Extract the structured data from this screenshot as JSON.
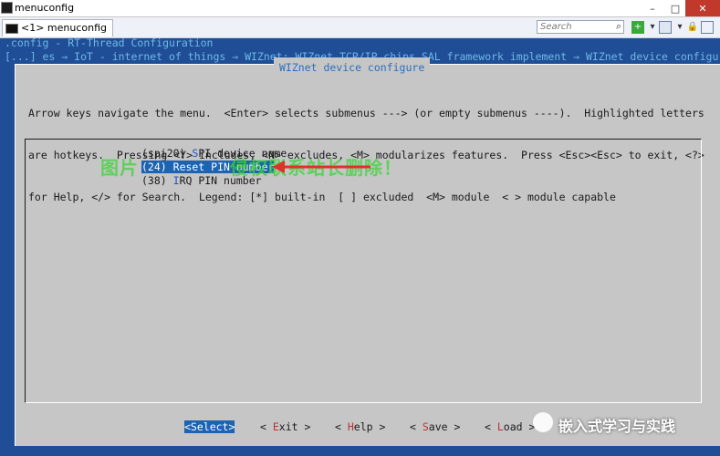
{
  "window": {
    "title": "menuconfig",
    "controls": [
      "–",
      "□",
      "✕"
    ]
  },
  "tabbar": {
    "tab_label": "<1> menuconfig",
    "search_placeholder": "Search"
  },
  "terminal": {
    "line1": ".config - RT-Thread Configuration",
    "line2": "[...] es → IoT - internet of things → WIZnet: WIZnet TCP/IP chips SAL framework implement → WIZnet device configure"
  },
  "dialog": {
    "title": "WIZnet device configure",
    "help": [
      "Arrow keys navigate the menu.  <Enter> selects submenus ---> (or empty submenus ----).  Highlighted letters",
      "are hotkeys.  Pressing <Y> includes, <N> excludes, <M> modularizes features.  Press <Esc><Esc> to exit, <?>",
      "for Help, </> for Search.  Legend: [*] built-in  [ ] excluded  <M> module  < > module capable"
    ],
    "items": [
      {
        "prefix": "(spi20) ",
        "hotkey": "S",
        "rest": "PI device name",
        "selected": false
      },
      {
        "prefix": "(24) ",
        "hotkey": "R",
        "rest": "eset PIN number",
        "selected": true
      },
      {
        "prefix": "(38) ",
        "hotkey": "I",
        "rest": "RQ PIN number",
        "selected": false
      }
    ],
    "buttons": {
      "select": "<Select>",
      "exit_pre": "< ",
      "exit_hot": "E",
      "exit_rest": "xit >",
      "help_pre": "< ",
      "help_hot": "H",
      "help_rest": "elp >",
      "save_pre": "< ",
      "save_hot": "S",
      "save_rest": "ave >",
      "load_pre": "< ",
      "load_hot": "L",
      "load_rest": "oad >"
    }
  },
  "overlay": {
    "watermark": "图片",
    "watermark_tail": "侵权联系站长删除！",
    "brand": "嵌入式学习与实践"
  },
  "colors": {
    "terminal_bg": "#1f4e96",
    "dialog_bg": "#c6c6c6",
    "selection": "#1c63b2",
    "arrow": "#e0302a"
  }
}
